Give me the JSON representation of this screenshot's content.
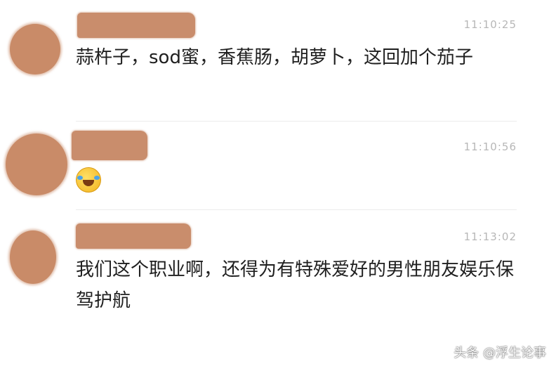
{
  "messages": [
    {
      "time": "11:10:25",
      "text": "蒜杵子，sod蜜，香蕉肠，胡萝卜，这回加个茄子"
    },
    {
      "time": "11:10:56",
      "emoji": "laughing-tears-emoji"
    },
    {
      "time": "11:13:02",
      "text": "我们这个职业啊，还得为有特殊爱好的男性朋友娱乐保驾护航"
    }
  ],
  "watermark": "头条 @浮生论事",
  "colors": {
    "redaction": "#c98b68",
    "timestamp": "#b7b7b7",
    "text": "#1f1f1f"
  }
}
